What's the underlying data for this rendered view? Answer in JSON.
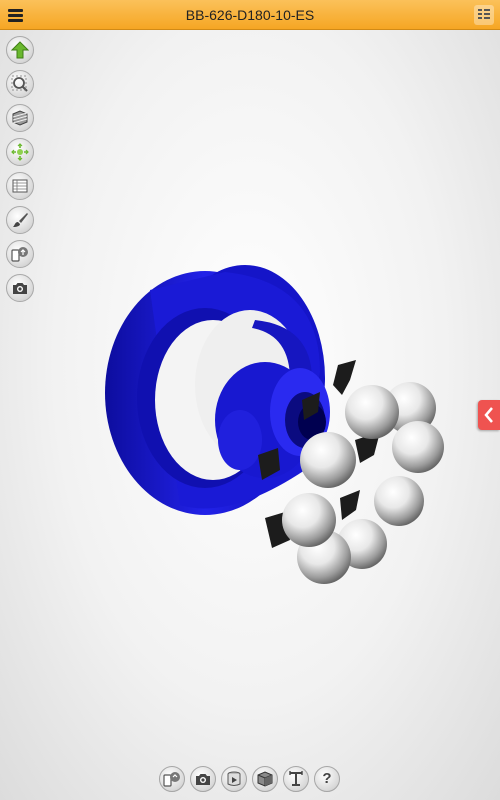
{
  "header": {
    "title": "BB-626-D180-10-ES",
    "menu_icon": "hamburger-menu-icon",
    "right_icon": "component-list-icon"
  },
  "left_toolbar": [
    {
      "name": "home-view",
      "icon": "green-up-arrow-icon"
    },
    {
      "name": "zoom-fit",
      "icon": "zoom-icon"
    },
    {
      "name": "section-view",
      "icon": "section-cube-icon"
    },
    {
      "name": "explode",
      "icon": "explode-icon"
    },
    {
      "name": "bill-of-materials",
      "icon": "table-grid-icon"
    },
    {
      "name": "appearance",
      "icon": "paint-brush-icon"
    },
    {
      "name": "switch-view",
      "icon": "device-switch-icon"
    },
    {
      "name": "screenshot",
      "icon": "camera-icon"
    }
  ],
  "bottom_toolbar": [
    {
      "name": "configurations",
      "icon": "device-switch-icon"
    },
    {
      "name": "capture",
      "icon": "camera-icon"
    },
    {
      "name": "animation",
      "icon": "play-cylinder-icon"
    },
    {
      "name": "display-style",
      "icon": "shaded-cube-icon"
    },
    {
      "name": "measure",
      "icon": "measure-icon"
    },
    {
      "name": "help",
      "icon": "question-icon",
      "label": "?"
    }
  ],
  "side_panel_toggle": {
    "icon": "chevron-left-icon"
  },
  "colors": {
    "header": "#f6a623",
    "bearing_ring": "#1a1ad6",
    "cage": "#1c1c1c",
    "balls": "#e6e6e6",
    "side_tab": "#ef5350",
    "home_arrow": "#6ab82e"
  }
}
